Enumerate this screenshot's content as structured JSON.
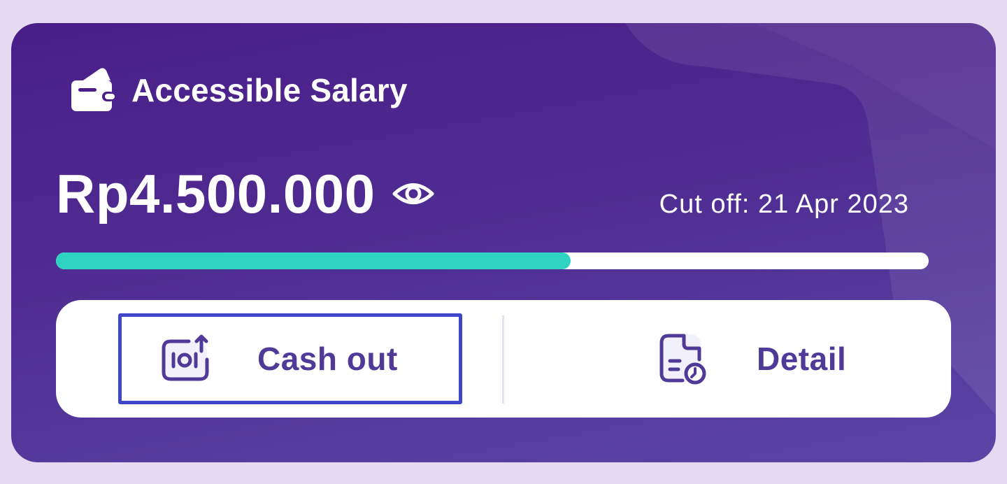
{
  "salary_card": {
    "title": "Accessible Salary",
    "title_icon": "wallet-icon",
    "amount": "Rp4.500.000",
    "visibility_icon": "eye-icon",
    "cutoff_text": "Cut off: 21 Apr 2023",
    "progress_fraction": 0.59,
    "colors": {
      "card_start": "#4a1d88",
      "card_end": "#5a45a6",
      "progress_fill": "#2ed3c2",
      "action_text": "#4f3a98",
      "focus_outline": "#3f46c9"
    }
  },
  "actions": [
    {
      "label": "Cash out",
      "icon": "cash-out-icon"
    },
    {
      "label": "Detail",
      "icon": "document-clock-icon"
    }
  ]
}
